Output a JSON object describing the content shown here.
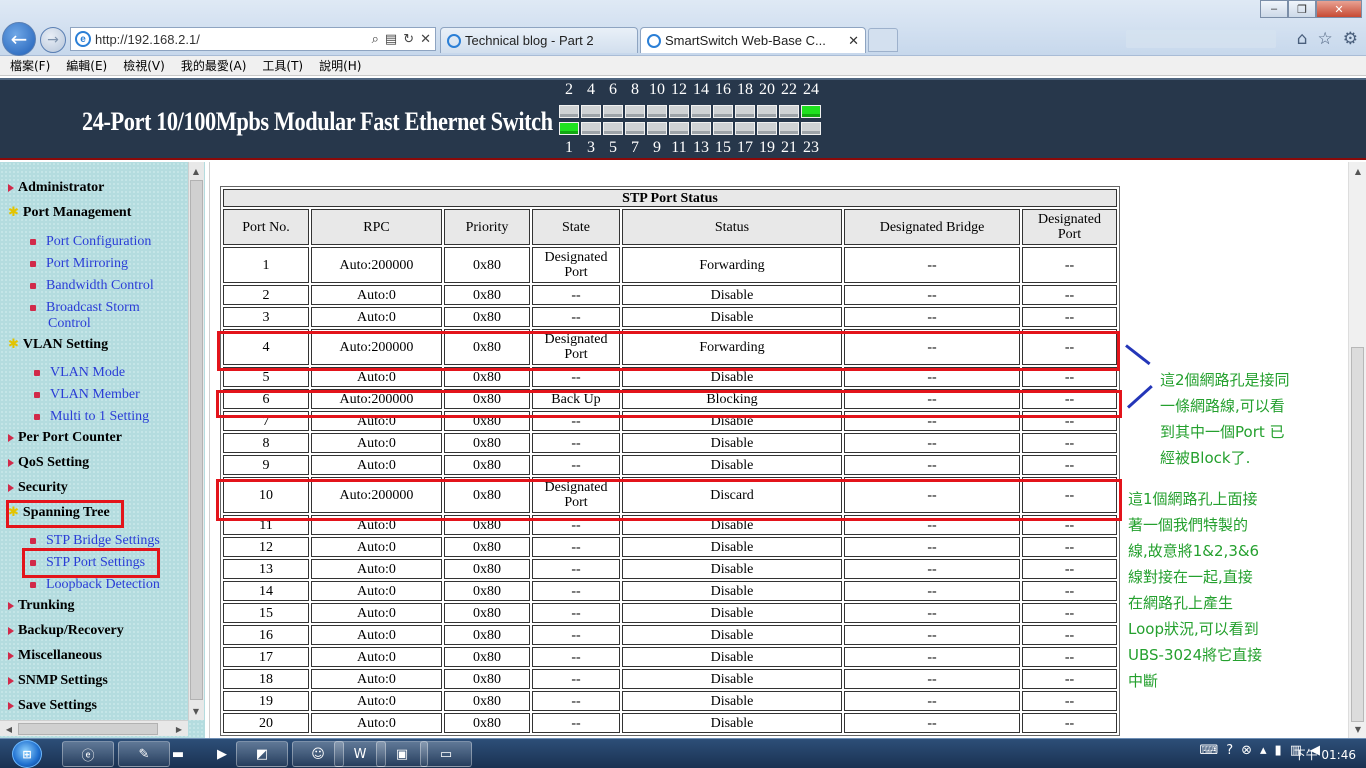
{
  "browser": {
    "address": "http://192.168.2.1/",
    "tabs": [
      {
        "label": "Technical blog - Part 2"
      },
      {
        "label": "SmartSwitch Web-Base C..."
      }
    ],
    "menu": [
      "檔案(F)",
      "編輯(E)",
      "檢視(V)",
      "我的最愛(A)",
      "工具(T)",
      "說明(H)"
    ]
  },
  "banner": {
    "title": "24-Port 10/100Mpbs Modular Fast Ethernet Switch",
    "top_ports": [
      "2",
      "4",
      "6",
      "8",
      "10",
      "12",
      "14",
      "16",
      "18",
      "20",
      "22",
      "24"
    ],
    "bottom_ports": [
      "1",
      "3",
      "5",
      "7",
      "9",
      "11",
      "13",
      "15",
      "17",
      "19",
      "21",
      "23"
    ],
    "active_ports": [
      "1",
      "24"
    ]
  },
  "nav": {
    "administrator": "Administrator",
    "port_management": "Port Management",
    "port_configuration": "Port Configuration",
    "port_mirroring": "Port Mirroring",
    "bandwidth_control": "Bandwidth Control",
    "broadcast_storm_1": "Broadcast Storm",
    "broadcast_storm_2": "Control",
    "vlan_setting": "VLAN Setting",
    "vlan_mode": "VLAN Mode",
    "vlan_member": "VLAN Member",
    "multi_to_1": "Multi to 1 Setting",
    "per_port_counter": "Per Port Counter",
    "qos_setting": "QoS Setting",
    "security": "Security",
    "spanning_tree": "Spanning Tree",
    "stp_bridge_settings": "STP Bridge Settings",
    "stp_port_settings": "STP Port Settings",
    "loopback_detection": "Loopback Detection",
    "trunking": "Trunking",
    "backup_recovery": "Backup/Recovery",
    "miscellaneous": "Miscellaneous",
    "snmp_settings": "SNMP Settings",
    "save_settings": "Save Settings"
  },
  "table": {
    "title": "STP Port Status",
    "headers": {
      "port_no": "Port No.",
      "rpc": "RPC",
      "priority": "Priority",
      "state": "State",
      "status": "Status",
      "designated_bridge": "Designated Bridge",
      "designated_port_1": "Designated",
      "designated_port_2": "Port"
    },
    "rows": [
      {
        "port": "1",
        "rpc": "Auto:200000",
        "priority": "0x80",
        "state1": "Designated",
        "state2": "Port",
        "status": "Forwarding",
        "bridge": "--",
        "dport": "--"
      },
      {
        "port": "2",
        "rpc": "Auto:0",
        "priority": "0x80",
        "state1": "--",
        "state2": "",
        "status": "Disable",
        "bridge": "--",
        "dport": "--"
      },
      {
        "port": "3",
        "rpc": "Auto:0",
        "priority": "0x80",
        "state1": "--",
        "state2": "",
        "status": "Disable",
        "bridge": "--",
        "dport": "--"
      },
      {
        "port": "4",
        "rpc": "Auto:200000",
        "priority": "0x80",
        "state1": "Designated",
        "state2": "Port",
        "status": "Forwarding",
        "bridge": "--",
        "dport": "--"
      },
      {
        "port": "5",
        "rpc": "Auto:0",
        "priority": "0x80",
        "state1": "--",
        "state2": "",
        "status": "Disable",
        "bridge": "--",
        "dport": "--"
      },
      {
        "port": "6",
        "rpc": "Auto:200000",
        "priority": "0x80",
        "state1": "Back Up",
        "state2": "",
        "status": "Blocking",
        "bridge": "--",
        "dport": "--"
      },
      {
        "port": "7",
        "rpc": "Auto:0",
        "priority": "0x80",
        "state1": "--",
        "state2": "",
        "status": "Disable",
        "bridge": "--",
        "dport": "--"
      },
      {
        "port": "8",
        "rpc": "Auto:0",
        "priority": "0x80",
        "state1": "--",
        "state2": "",
        "status": "Disable",
        "bridge": "--",
        "dport": "--"
      },
      {
        "port": "9",
        "rpc": "Auto:0",
        "priority": "0x80",
        "state1": "--",
        "state2": "",
        "status": "Disable",
        "bridge": "--",
        "dport": "--"
      },
      {
        "port": "10",
        "rpc": "Auto:200000",
        "priority": "0x80",
        "state1": "Designated",
        "state2": "Port",
        "status": "Discard",
        "bridge": "--",
        "dport": "--"
      },
      {
        "port": "11",
        "rpc": "Auto:0",
        "priority": "0x80",
        "state1": "--",
        "state2": "",
        "status": "Disable",
        "bridge": "--",
        "dport": "--"
      },
      {
        "port": "12",
        "rpc": "Auto:0",
        "priority": "0x80",
        "state1": "--",
        "state2": "",
        "status": "Disable",
        "bridge": "--",
        "dport": "--"
      },
      {
        "port": "13",
        "rpc": "Auto:0",
        "priority": "0x80",
        "state1": "--",
        "state2": "",
        "status": "Disable",
        "bridge": "--",
        "dport": "--"
      },
      {
        "port": "14",
        "rpc": "Auto:0",
        "priority": "0x80",
        "state1": "--",
        "state2": "",
        "status": "Disable",
        "bridge": "--",
        "dport": "--"
      },
      {
        "port": "15",
        "rpc": "Auto:0",
        "priority": "0x80",
        "state1": "--",
        "state2": "",
        "status": "Disable",
        "bridge": "--",
        "dport": "--"
      },
      {
        "port": "16",
        "rpc": "Auto:0",
        "priority": "0x80",
        "state1": "--",
        "state2": "",
        "status": "Disable",
        "bridge": "--",
        "dport": "--"
      },
      {
        "port": "17",
        "rpc": "Auto:0",
        "priority": "0x80",
        "state1": "--",
        "state2": "",
        "status": "Disable",
        "bridge": "--",
        "dport": "--"
      },
      {
        "port": "18",
        "rpc": "Auto:0",
        "priority": "0x80",
        "state1": "--",
        "state2": "",
        "status": "Disable",
        "bridge": "--",
        "dport": "--"
      },
      {
        "port": "19",
        "rpc": "Auto:0",
        "priority": "0x80",
        "state1": "--",
        "state2": "",
        "status": "Disable",
        "bridge": "--",
        "dport": "--"
      },
      {
        "port": "20",
        "rpc": "Auto:0",
        "priority": "0x80",
        "state1": "--",
        "state2": "",
        "status": "Disable",
        "bridge": "--",
        "dport": "--"
      }
    ]
  },
  "annotations": {
    "note_1": "這2個網路孔是接同\n一條網路線,可以看\n到其中一個Port 已\n經被Block了.",
    "note_2": "這1個網路孔上面接\n著一個我們特製的\n線,故意將1&2,3&6\n線對接在一起,直接\n在網路孔上產生\nLoop狀況,可以看到\nUBS-3024將它直接\n中斷"
  },
  "taskbar": {
    "clock": "下午 01:46"
  },
  "colors": {
    "banner_bg": "#27374b",
    "nav_bg": "#b4dcdf",
    "nav_link": "#2a3dd6",
    "highlight_box": "#e3141b",
    "annotation_text": "#24a02e",
    "port_up": "#1fe11f"
  }
}
